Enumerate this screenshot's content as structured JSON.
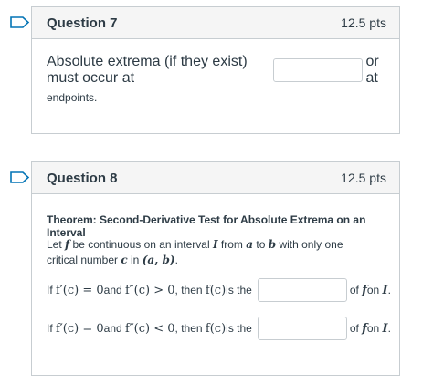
{
  "question7": {
    "title": "Question 7",
    "points": "12.5 pts",
    "prompt_before": "Absolute extrema (if they exist) must occur at",
    "prompt_after": "or at",
    "prompt_line2": "endpoints.",
    "answer_value": ""
  },
  "question8": {
    "title": "Question 8",
    "points": "12.5 pts",
    "theorem_title": "Theorem: Second-Derivative Test for Absolute Extrema on an Interval",
    "theorem_text": {
      "t1": "Let ",
      "f": "f",
      "t2": " be continuous on an interval ",
      "I": "I",
      "t3": " from ",
      "a": "a",
      "t4": " to ",
      "b": "b",
      "t5": " with only one critical number ",
      "c": "c",
      "t6": " in ",
      "ab": "(a, b)",
      "t7": "."
    },
    "row1": {
      "if": "If ",
      "cond1": "f′(c) = 0",
      "and": " and ",
      "cond2": "f″(c) > 0",
      "then": ", then ",
      "fc": "f(c)",
      "isthe": " is the",
      "of": " of ",
      "f": "f",
      "on": " on ",
      "I": "I",
      "end": ".",
      "answer_value": ""
    },
    "row2": {
      "if": "If ",
      "cond1": "f′(c) = 0",
      "and": " and ",
      "cond2": "f″(c) < 0",
      "then": ", then ",
      "fc": "f(c)",
      "isthe": " is the",
      "of": " of ",
      "f": "f",
      "on": " on ",
      "I": "I",
      "end": ".",
      "answer_value": ""
    }
  },
  "colors": {
    "flag": "#0374b5",
    "header_bg": "#f5f5f5",
    "border": "#c7cdd1",
    "text": "#2d3b45"
  },
  "icons": {
    "flag": "bookmark-flag-icon"
  }
}
